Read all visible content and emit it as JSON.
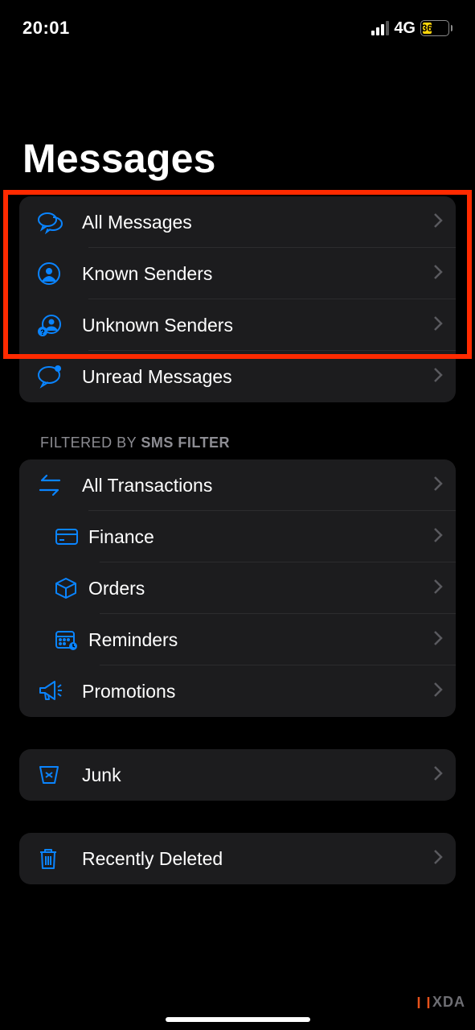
{
  "status": {
    "time": "20:01",
    "network": "4G",
    "battery_percent": "36"
  },
  "title": "Messages",
  "group1": [
    {
      "label": "All Messages"
    },
    {
      "label": "Known Senders"
    },
    {
      "label": "Unknown Senders"
    },
    {
      "label": "Unread Messages"
    }
  ],
  "filter_header_prefix": "FILTERED BY ",
  "filter_header_bold": "SMS FILTER",
  "group2": [
    {
      "label": "All Transactions"
    },
    {
      "label": "Finance"
    },
    {
      "label": "Orders"
    },
    {
      "label": "Reminders"
    },
    {
      "label": "Promotions"
    }
  ],
  "junk_label": "Junk",
  "deleted_label": "Recently Deleted",
  "watermark_text": "XDA"
}
